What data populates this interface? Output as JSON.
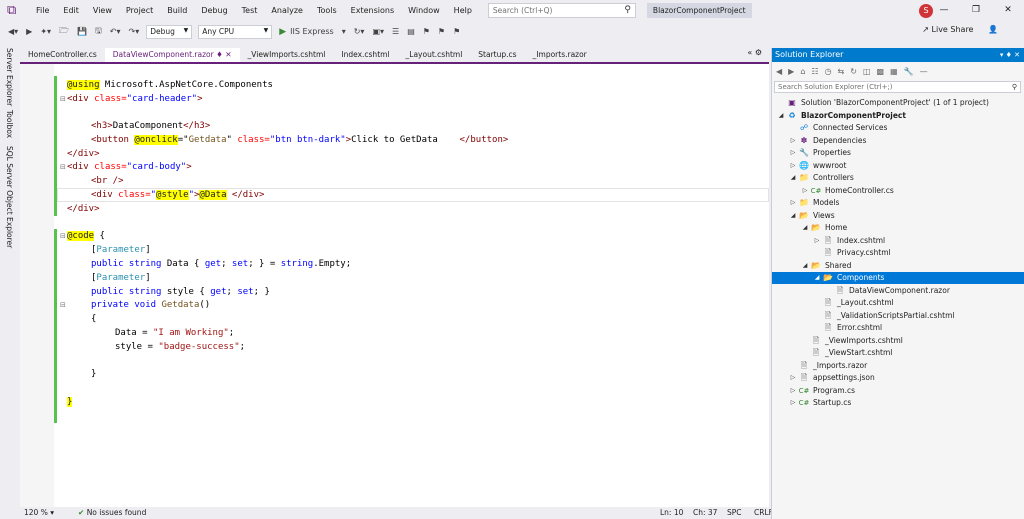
{
  "menubar": {
    "items": [
      "File",
      "Edit",
      "View",
      "Project",
      "Build",
      "Debug",
      "Test",
      "Analyze",
      "Tools",
      "Extensions",
      "Window",
      "Help"
    ],
    "search_placeholder": "Search (Ctrl+Q)",
    "project_name": "BlazorComponentProject",
    "avatar_letter": "S"
  },
  "toolbar": {
    "config": "Debug",
    "platform": "Any CPU",
    "run_label": "IIS Express",
    "live_share": "Live Share"
  },
  "side_tabs": [
    "Server Explorer",
    "Toolbox",
    "SQL Server Object Explorer"
  ],
  "tabs": [
    {
      "label": "HomeController.cs",
      "active": false
    },
    {
      "label": "DataViewComponent.razor",
      "active": true
    },
    {
      "label": "_ViewImports.cshtml",
      "active": false
    },
    {
      "label": "Index.cshtml",
      "active": false
    },
    {
      "label": "_Layout.cshtml",
      "active": false
    },
    {
      "label": "Startup.cs",
      "active": false
    },
    {
      "label": "_Imports.razor",
      "active": false
    }
  ],
  "tab_controls": "« ⚙",
  "code": {
    "l1_directive": "@using",
    "l1_ns": " Microsoft.AspNetCore.Components",
    "l2_open": "<div",
    "l2_attr": " class=",
    "l2_val": "\"card-header\"",
    "l2_close": ">",
    "l4_h3open": "<h3>",
    "l4_text": "DataComponent",
    "l4_h3close": "</h3>",
    "l5_btn": "<button",
    "l5_onclick": "@onclick",
    "l5_eq": "=\"",
    "l5_method": "Getdata",
    "l5_q": "\"",
    "l5_classattr": " class=",
    "l5_classval": "\"btn btn-dark\"",
    "l5_gt": ">",
    "l5_text": "Click to GetData    ",
    "l5_btnclose": "</button>",
    "l6_divclose": "</div>",
    "l7_open": "<div",
    "l7_attr": " class=",
    "l7_val": "\"card-body\"",
    "l7_close": ">",
    "l8_br": "<br />",
    "l9_open": "<div",
    "l9_attr": " class=",
    "l9_q1": "\"",
    "l9_style": "@style",
    "l9_q2": "\"",
    "l9_gt": ">",
    "l9_data": "@Data",
    "l9_close": " </div>",
    "l10_divclose": "</div>",
    "l12_code": "@code",
    "l12_brace": " {",
    "l13_param": "Parameter",
    "l14_kw1": "public",
    "l14_kw2": " string",
    "l14_name": " Data { ",
    "l14_get": "get",
    "l14_semi1": "; ",
    "l14_set": "set",
    "l14_semi2": "; } = ",
    "l14_str": "string",
    "l14_empty": ".Empty;",
    "l15_param": "Parameter",
    "l16_kw1": "public",
    "l16_kw2": " string",
    "l16_name": " style { ",
    "l16_get": "get",
    "l16_semi1": "; ",
    "l16_set": "set",
    "l16_semi2": "; }",
    "l17_kw1": "private",
    "l17_kw2": " void",
    "l17_method": " Getdata",
    "l17_parens": "()",
    "l18_brace": "{",
    "l19_lhs": "Data = ",
    "l19_str": "\"I am Working\"",
    "l19_semi": ";",
    "l20_lhs": "style = ",
    "l20_str": "\"badge-success\"",
    "l20_semi": ";",
    "l22_brace": "}",
    "l24_brace": "}"
  },
  "status": {
    "zoom": "120 %",
    "issues": "No issues found",
    "ln": "Ln: 10",
    "ch": "Ch: 37",
    "spc": "SPC",
    "crlf": "CRLF"
  },
  "solution_explorer": {
    "title": "Solution Explorer",
    "search_placeholder": "Search Solution Explorer (Ctrl+;)",
    "items": [
      {
        "label": "Solution 'BlazorComponentProject' (1 of 1 project)",
        "icon": "solution-icon"
      },
      {
        "label": "BlazorComponentProject",
        "icon": "web-project-icon"
      },
      {
        "label": "Connected Services",
        "icon": "connected-services-icon"
      },
      {
        "label": "Dependencies",
        "icon": "dependencies-icon"
      },
      {
        "label": "Properties",
        "icon": "properties-icon"
      },
      {
        "label": "wwwroot",
        "icon": "globe-icon"
      },
      {
        "label": "Controllers",
        "icon": "folder-icon"
      },
      {
        "label": "HomeController.cs",
        "icon": "csharp-file-icon"
      },
      {
        "label": "Models",
        "icon": "folder-icon"
      },
      {
        "label": "Views",
        "icon": "folder-icon"
      },
      {
        "label": "Home",
        "icon": "folder-icon"
      },
      {
        "label": "Index.cshtml",
        "icon": "razor-file-icon"
      },
      {
        "label": "Privacy.cshtml",
        "icon": "razor-file-icon"
      },
      {
        "label": "Shared",
        "icon": "folder-icon"
      },
      {
        "label": "Components",
        "icon": "folder-icon"
      },
      {
        "label": "DataViewComponent.razor",
        "icon": "razor-file-icon"
      },
      {
        "label": "_Layout.cshtml",
        "icon": "razor-file-icon"
      },
      {
        "label": "_ValidationScriptsPartial.cshtml",
        "icon": "razor-file-icon"
      },
      {
        "label": "Error.cshtml",
        "icon": "razor-file-icon"
      },
      {
        "label": "_ViewImports.cshtml",
        "icon": "razor-file-icon"
      },
      {
        "label": "_ViewStart.cshtml",
        "icon": "razor-file-icon"
      },
      {
        "label": "_Imports.razor",
        "icon": "razor-file-icon"
      },
      {
        "label": "appsettings.json",
        "icon": "json-file-icon"
      },
      {
        "label": "Program.cs",
        "icon": "csharp-file-icon"
      },
      {
        "label": "Startup.cs",
        "icon": "csharp-file-icon"
      }
    ]
  },
  "colors": {
    "accent": "#68217a",
    "selection": "#0078d7",
    "title_blue": "#007acc",
    "change_bar": "#57c24f"
  }
}
